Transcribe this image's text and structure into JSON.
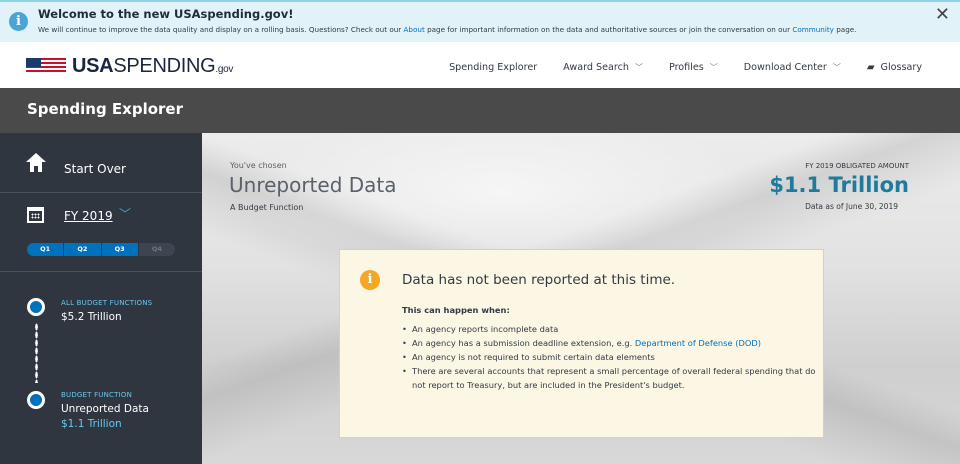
{
  "banner": {
    "title": "Welcome to the new USAspending.gov!",
    "text_before": "We will continue to improve the data quality and display on a rolling basis. Questions? Check out our ",
    "link_about": "About",
    "text_middle": " page for important information on the data and authoritative sources or join the conversation on our ",
    "link_community": "Community",
    "text_after": " page.",
    "close": "✕"
  },
  "header": {
    "logo_bold": "USA",
    "logo_regular": "SPENDING",
    "logo_suffix": ".gov",
    "nav": [
      {
        "label": "Spending Explorer"
      },
      {
        "label": "Award Search"
      },
      {
        "label": "Profiles"
      },
      {
        "label": "Download Center"
      },
      {
        "label": "Glossary"
      }
    ]
  },
  "titlebar": {
    "title": "Spending Explorer"
  },
  "sidebar": {
    "start_over": "Start Over",
    "fiscal_year": "FY 2019",
    "quarters": [
      {
        "label": "Q1",
        "active": true
      },
      {
        "label": "Q2",
        "active": true
      },
      {
        "label": "Q3",
        "active": true
      },
      {
        "label": "Q4",
        "active": false
      }
    ],
    "breadcrumbs": [
      {
        "category": "ALL BUDGET FUNCTIONS",
        "value": "$5.2 Trillion"
      },
      {
        "category": "BUDGET FUNCTION",
        "value": "Unreported Data",
        "amount": "$1.1 Trillion"
      }
    ]
  },
  "main": {
    "chosen_label": "You've chosen",
    "chosen_title": "Unreported Data",
    "chosen_subtitle": "A Budget Function",
    "amount_label": "FY 2019 OBLIGATED AMOUNT",
    "amount_value": "$1.1 Trillion",
    "amount_date": "Data as of June 30, 2019",
    "notice": {
      "title": "Data has not been reported at this time.",
      "intro": "This can happen when:",
      "item1": "An agency reports incomplete data",
      "item2_text": "An agency has a submission deadline extension, e.g. ",
      "item2_link": "Department of Defense (DOD)",
      "item3": "An agency is not required to submit certain data elements",
      "item4": "There are several accounts that represent a small percentage of overall federal spending that do not report to Treasury, but are included in the President's budget."
    }
  },
  "colors": {
    "accent": "#0071bc",
    "amount": "#1f7a9c",
    "sidebar": "#2f3640",
    "notice_bg": "#fcf6e4"
  }
}
